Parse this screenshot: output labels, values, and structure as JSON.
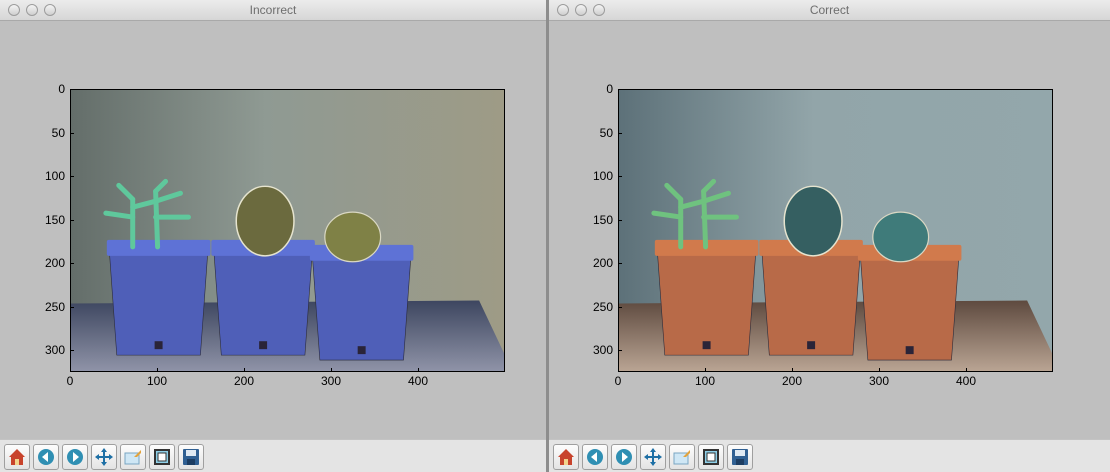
{
  "windows": [
    {
      "title": "Incorrect",
      "photo_variant": "incorrect",
      "y_ticks": [
        "0",
        "50",
        "100",
        "150",
        "200",
        "250",
        "300"
      ],
      "x_ticks": [
        "0",
        "100",
        "200",
        "300",
        "400"
      ],
      "toolbar": [
        "home-icon",
        "back-icon",
        "forward-icon",
        "pan-icon",
        "zoom-icon",
        "subplots-icon",
        "save-icon"
      ]
    },
    {
      "title": "Correct",
      "photo_variant": "correct",
      "y_ticks": [
        "0",
        "50",
        "100",
        "150",
        "200",
        "250",
        "300"
      ],
      "x_ticks": [
        "0",
        "100",
        "200",
        "300",
        "400"
      ],
      "toolbar": [
        "home-icon",
        "back-icon",
        "forward-icon",
        "pan-icon",
        "zoom-icon",
        "subplots-icon",
        "save-icon"
      ]
    }
  ],
  "colors": {
    "figure_bg": "#bfbfbf",
    "toolbar_bg": "#e4e4e4",
    "incorrect_pots": "#4f5fb8",
    "correct_pots": "#b86a48",
    "incorrect_cactus": "#5fc89c",
    "correct_cactus": "#6fc27f"
  }
}
